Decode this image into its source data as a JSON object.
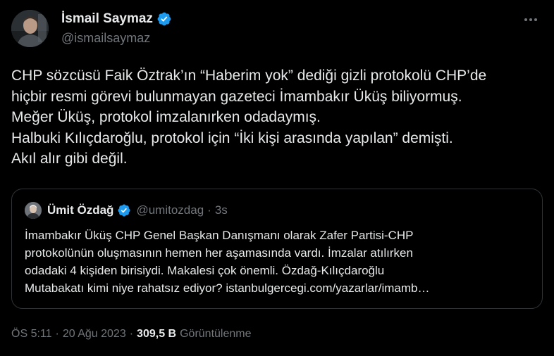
{
  "colors": {
    "background": "#000000",
    "text": "#e7e9ea",
    "secondary_text": "#71767b",
    "verified_badge": "#1d9bf0",
    "border": "#2f3336"
  },
  "author": {
    "display_name": "İsmail Saymaz",
    "handle": "@ismailsaymaz",
    "verified_icon": "verified-badge-icon"
  },
  "more_icon": "more-options-icon",
  "tweet": {
    "lines": [
      "CHP sözcüsü Faik Öztrak’ın “Haberim yok” dediği gizli protokolü CHP’de",
      "hiçbir resmi görevi bulunmayan gazeteci İmambakır Üküş biliyormuş.",
      "Meğer Üküş, protokol imzalanırken odadaymış.",
      "Halbuki Kılıçdaroğlu, protokol için “İki kişi arasında yapılan” demişti.",
      "Akıl alır gibi değil."
    ]
  },
  "quote": {
    "display_name": "Ümit Özdağ",
    "handle": "@umitozdag",
    "separator": "·",
    "time": "3s",
    "lines": [
      "İmambakır Üküş CHP Genel Başkan Danışmanı olarak Zafer Partisi-CHP",
      "protokolünün oluşmasının hemen her aşamasında vardı. İmzalar atılırken",
      "odadaki 4 kişiden birisiydi. Makalesi çok önemli. Özdağ-Kılıçdaroğlu",
      "Mutabakatı kimi niye rahatsız ediyor?  istanbulgercegi.com/yazarlar/imamb…"
    ]
  },
  "meta": {
    "time": "ÖS 5:11",
    "separator1": "·",
    "date": "20 Ağu 2023",
    "separator2": "·",
    "views_count": "309,5 B",
    "views_label": "Görüntülenme"
  }
}
